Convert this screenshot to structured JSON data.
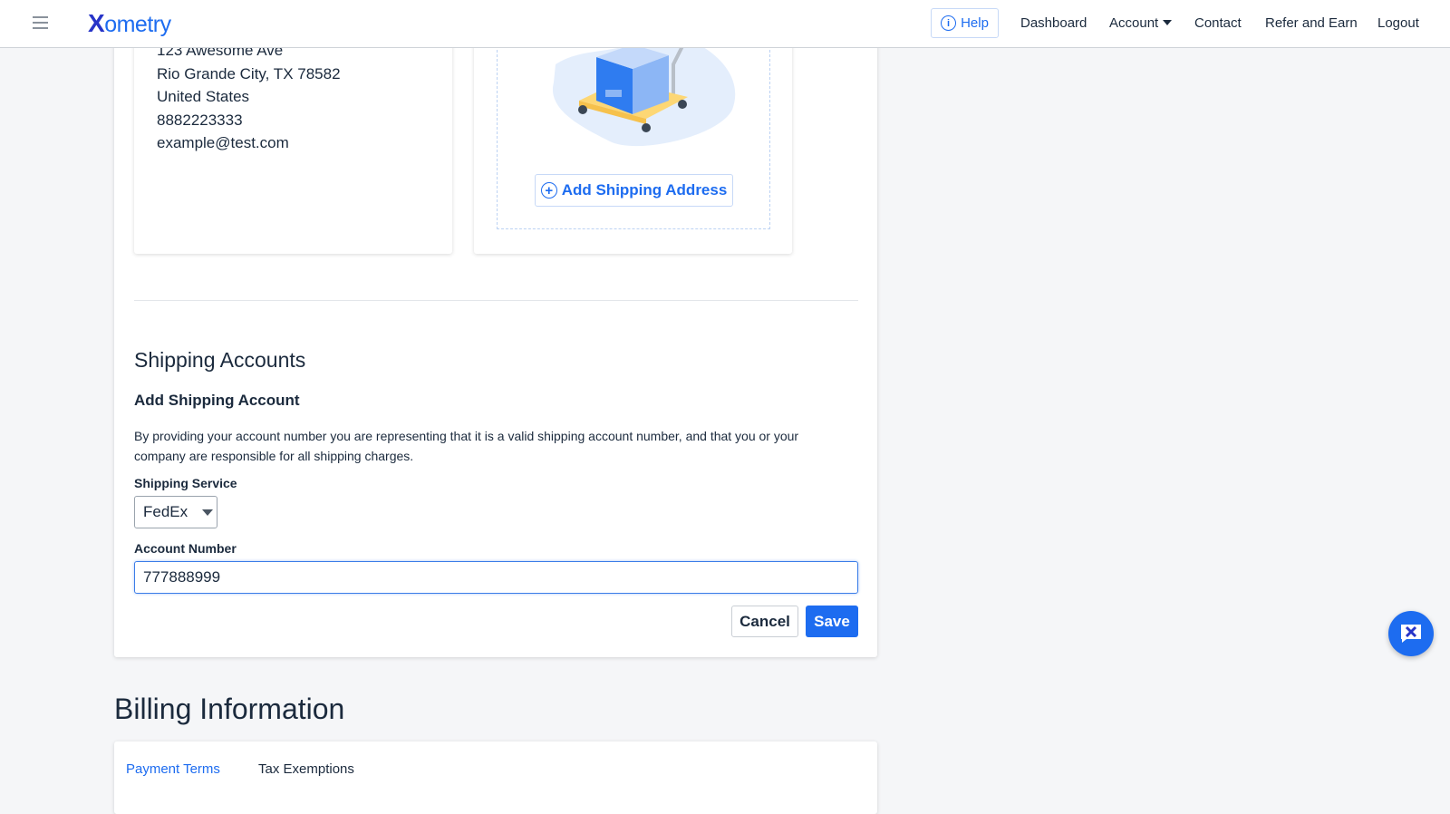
{
  "header": {
    "logo": "Xometry",
    "help": "Help",
    "nav": [
      "Dashboard",
      "Account",
      "Contact",
      "Refer and Earn",
      "Logout"
    ]
  },
  "address_card": {
    "lines": [
      "123 Awesome Ave",
      "Rio Grande City, TX 78582",
      "United States",
      "8882223333",
      "example@test.com"
    ]
  },
  "shipping_card": {
    "add_button": "Add Shipping Address"
  },
  "shipping_accounts": {
    "title": "Shipping Accounts",
    "subtitle": "Add Shipping Account",
    "disclaimer_1": "By providing your account number you are representing that it is a valid shipping account number, and that you or your",
    "disclaimer_2": "company are responsible for all shipping charges.",
    "service_label": "Shipping Service",
    "service_value": "FedEx",
    "account_label": "Account Number",
    "account_value": "777888999",
    "cancel": "Cancel",
    "save": "Save"
  },
  "billing": {
    "title": "Billing Information",
    "tabs": [
      "Payment Terms",
      "Tax Exemptions"
    ],
    "active_tab": "Payment Terms"
  },
  "colors": {
    "accent": "#1d6cf0",
    "text": "#1b2a3d",
    "background": "#f5f6f8"
  }
}
